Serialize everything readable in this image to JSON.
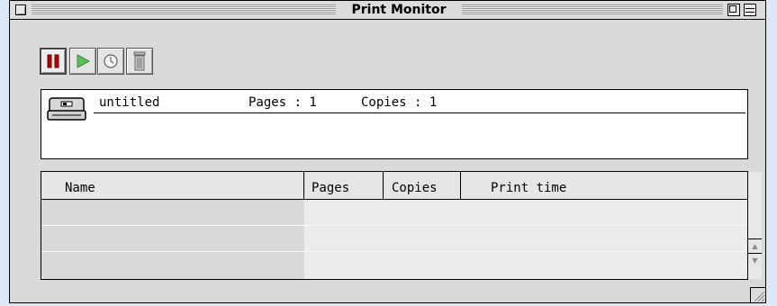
{
  "window": {
    "title": "Print Monitor"
  },
  "toolbar": {
    "buttons": [
      {
        "name": "pause",
        "icon": "pause-icon",
        "color": "#c00000"
      },
      {
        "name": "resume",
        "icon": "play-icon",
        "color": "#5cc25c"
      },
      {
        "name": "schedule",
        "icon": "clock-icon"
      },
      {
        "name": "delete",
        "icon": "trash-icon"
      }
    ]
  },
  "current_job": {
    "name": "untitled",
    "pages": "Pages : 1",
    "copies": "Copies : 1"
  },
  "queue": {
    "columns": [
      "Name",
      "Pages",
      "Copies",
      "Print time"
    ],
    "rows": [
      [
        "",
        "",
        "",
        ""
      ],
      [
        "",
        "",
        "",
        ""
      ],
      [
        "",
        "",
        "",
        ""
      ]
    ]
  },
  "colors": {
    "pause_red": "#c00000",
    "play_green": "#5cc25c",
    "background": "#dde9f7"
  }
}
